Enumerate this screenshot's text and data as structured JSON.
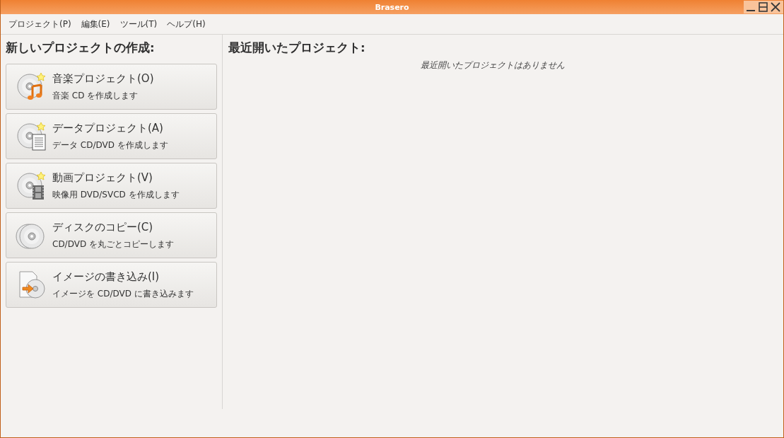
{
  "window": {
    "title": "Brasero"
  },
  "menu": [
    "プロジェクト(P)",
    "編集(E)",
    "ツール(T)",
    "ヘルプ(H)"
  ],
  "new_project": {
    "heading": "新しいプロジェクトの作成:",
    "items": [
      {
        "kind": "music",
        "title": "音楽プロジェクト(O)",
        "subtitle": "音楽  CD を作成します"
      },
      {
        "kind": "data",
        "title": "データプロジェクト(A)",
        "subtitle": "データ  CD/DVD を作成します"
      },
      {
        "kind": "video",
        "title": "動画プロジェクト(V)",
        "subtitle": "映像用  DVD/SVCD を作成します"
      },
      {
        "kind": "copy",
        "title": "ディスクのコピー(C)",
        "subtitle": "CD/DVD を丸ごとコピーします"
      },
      {
        "kind": "image",
        "title": "イメージの書き込み(I)",
        "subtitle": "イメージを  CD/DVD に書き込みます"
      }
    ]
  },
  "recent": {
    "heading": "最近開いたプロジェクト:",
    "empty_message": "最近開いたプロジェクトはありません"
  }
}
